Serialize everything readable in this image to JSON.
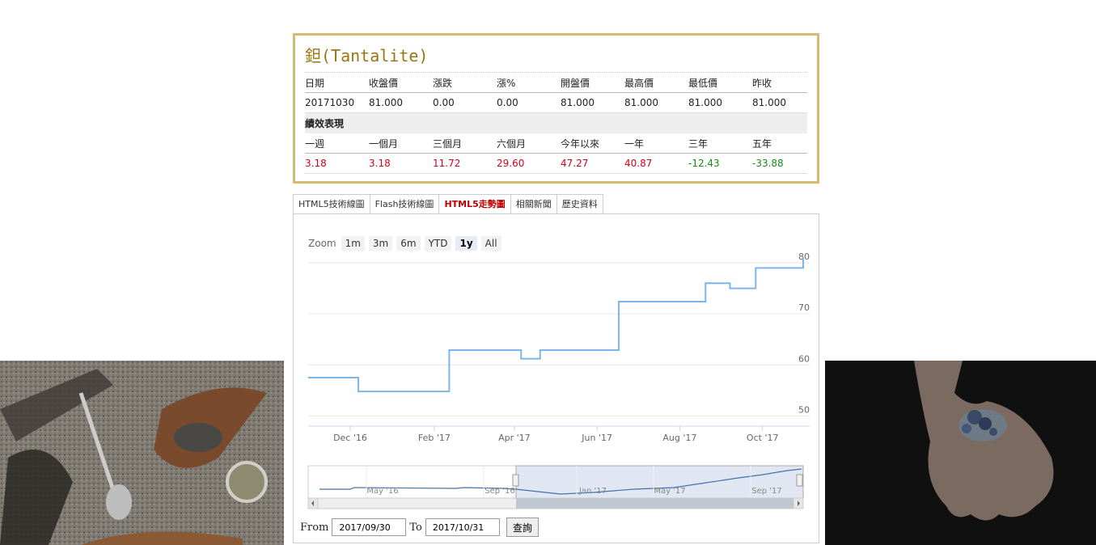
{
  "quote": {
    "title": "鉭(Tantalite)",
    "headers": [
      "日期",
      "收盤價",
      "漲跌",
      "漲%",
      "開盤價",
      "最高價",
      "最低價",
      "昨收"
    ],
    "values": [
      "20171030",
      "81.000",
      "0.00",
      "0.00",
      "81.000",
      "81.000",
      "81.000",
      "81.000"
    ],
    "perf_title": "績效表現",
    "perf_headers": [
      "一週",
      "一個月",
      "三個月",
      "六個月",
      "今年以來",
      "一年",
      "三年",
      "五年"
    ],
    "perf_values": [
      "3.18",
      "3.18",
      "11.72",
      "29.60",
      "47.27",
      "40.87",
      "-12.43",
      "-33.88"
    ],
    "perf_colors": [
      "red",
      "red",
      "red",
      "red",
      "red",
      "red",
      "green",
      "green"
    ]
  },
  "tabs": [
    "HTML5技術線圖",
    "Flash技術線圖",
    "HTML5走勢圖",
    "相關新聞",
    "歷史資料"
  ],
  "active_tab": 2,
  "zoom": {
    "label": "Zoom",
    "buttons": [
      "1m",
      "3m",
      "6m",
      "YTD",
      "1y",
      "All"
    ],
    "active": 4
  },
  "range": {
    "from_label": "From",
    "from_value": "2017/09/30",
    "to_label": "To",
    "to_value": "2017/10/31",
    "submit_label": "查詢"
  },
  "chart_data": {
    "type": "line",
    "x_labels": [
      "Dec '16",
      "Feb '17",
      "Apr '17",
      "Jun '17",
      "Aug '17",
      "Oct '17"
    ],
    "y_ticks": [
      50,
      60,
      70,
      80
    ],
    "ylim": [
      48,
      80
    ],
    "series": [
      {
        "x": [
          "2016-10-31",
          "2016-12-07",
          "2017-02-12",
          "2017-04-06",
          "2017-04-20",
          "2017-06-17",
          "2017-08-20",
          "2017-09-07",
          "2017-09-26",
          "2017-10-31"
        ],
        "values": [
          57.5,
          54.8,
          62.9,
          61.2,
          62.9,
          72.4,
          76.0,
          75.0,
          79.0,
          81.0
        ]
      }
    ],
    "navigator": {
      "x_labels": [
        "May '16",
        "Sep '16",
        "Jan '17",
        "May '17",
        "Sep '17"
      ],
      "selected_range": [
        "2016-10-31",
        "2017-10-31"
      ]
    },
    "color": "#7cb5ec",
    "grid": true
  }
}
